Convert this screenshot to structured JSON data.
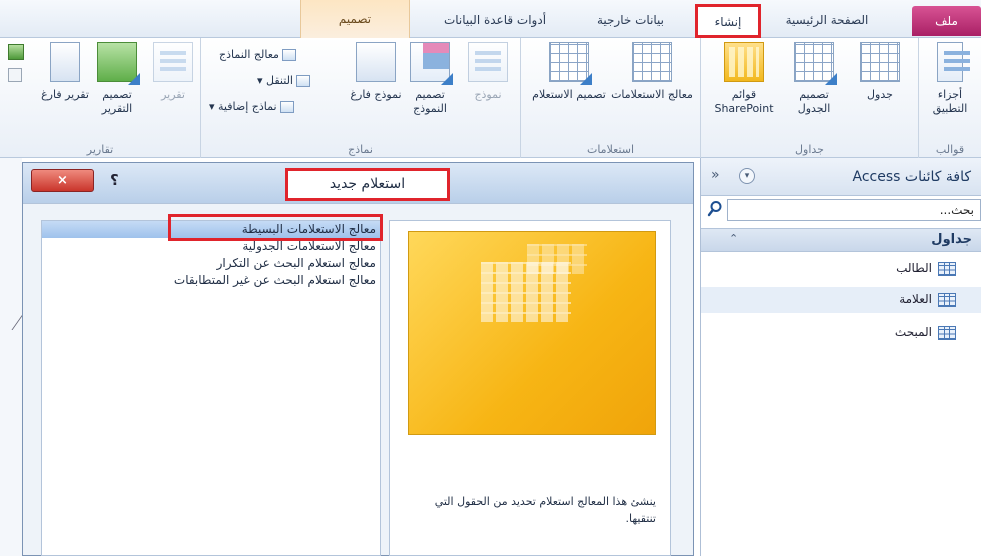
{
  "tabs": {
    "file": "ملف",
    "home": "الصفحة الرئيسية",
    "create": "إنشاء",
    "external": "بيانات خارجية",
    "dbtools": "أدوات قاعدة البيانات",
    "contextual": "تصميم"
  },
  "ribbon": {
    "templates": {
      "label": "قوالب",
      "app_parts": "أجزاء التطبيق"
    },
    "tables": {
      "label": "جداول",
      "table": "جدول",
      "table_design": "تصميم الجدول",
      "sharepoint_lists": "قوائم SharePoint"
    },
    "queries": {
      "label": "استعلامات",
      "query_wizard": "معالج الاستعلامات",
      "query_design": "تصميم الاستعلام"
    },
    "forms": {
      "label": "نماذج",
      "form": "نموذج",
      "form_design": "تصميم النموذج",
      "blank_form": "نموذج فارغ",
      "form_wizard": "معالج النماذج",
      "navigation": "التنقل",
      "more_forms": "نماذج إضافية"
    },
    "reports": {
      "label": "تقارير",
      "report": "تقرير",
      "report_design": "تصميم التقرير",
      "blank_report": "تقرير فارغ"
    }
  },
  "nav": {
    "title": "كافة كائنات Access",
    "collapse_glyph": "»",
    "dropdown_glyph": "▾",
    "search_placeholder": "بحث...",
    "section": "جداول",
    "section_chevron": "⌃",
    "items": [
      "الطالب",
      "العلامة",
      "المبحث"
    ]
  },
  "dialog": {
    "title": "استعلام جديد",
    "help": "؟",
    "close": "×",
    "wizards": [
      "معالج الاستعلامات البسيطة",
      "معالج الاستعلامات الجدولية",
      "معالج استعلام البحث عن التكرار",
      "معالج استعلام البحث عن غير المتطابقات"
    ],
    "description": "ينشئ هذا المعالج استعلام تحديد من الحقول التي تنتقيها."
  },
  "colors": {
    "file_tab": "#c2337a",
    "highlight": "#e0242c",
    "ribbon_bg": "#e9eff7",
    "preview_yellow": "#f7b514"
  },
  "icons": {
    "search": "search-icon",
    "table": "table-icon",
    "close": "close-icon",
    "help": "help-icon"
  }
}
